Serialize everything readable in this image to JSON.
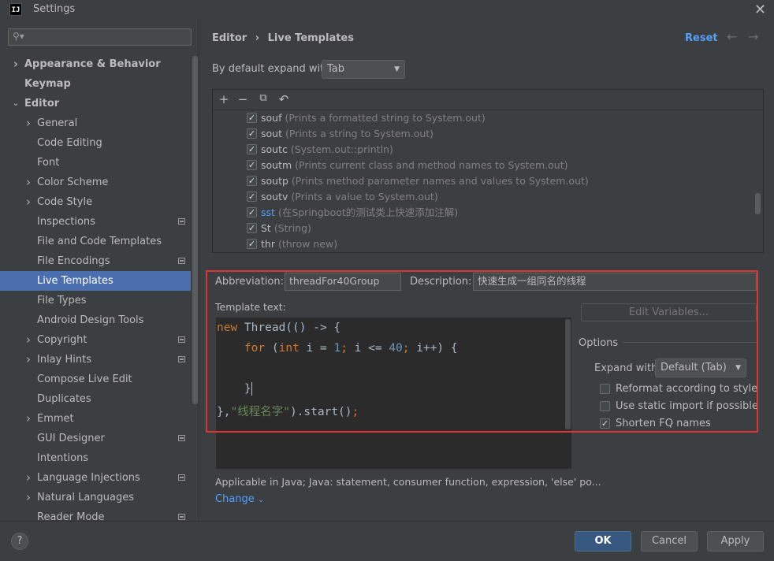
{
  "window": {
    "title": "Settings",
    "logo": "IJ"
  },
  "sidebar": {
    "search_placeholder": "",
    "items": [
      {
        "label": "Appearance & Behavior",
        "level": 0,
        "bold": true,
        "chevron": "right"
      },
      {
        "label": "Keymap",
        "level": 0,
        "bold": true
      },
      {
        "label": "Editor",
        "level": 0,
        "bold": true,
        "chevron": "down"
      },
      {
        "label": "General",
        "level": 1,
        "chevron": "right"
      },
      {
        "label": "Code Editing",
        "level": 1
      },
      {
        "label": "Font",
        "level": 1
      },
      {
        "label": "Color Scheme",
        "level": 1,
        "chevron": "right"
      },
      {
        "label": "Code Style",
        "level": 1,
        "chevron": "right"
      },
      {
        "label": "Inspections",
        "level": 1,
        "badge": true
      },
      {
        "label": "File and Code Templates",
        "level": 1
      },
      {
        "label": "File Encodings",
        "level": 1,
        "badge": true
      },
      {
        "label": "Live Templates",
        "level": 1,
        "selected": true
      },
      {
        "label": "File Types",
        "level": 1
      },
      {
        "label": "Android Design Tools",
        "level": 1
      },
      {
        "label": "Copyright",
        "level": 1,
        "chevron": "right",
        "badge": true
      },
      {
        "label": "Inlay Hints",
        "level": 1,
        "chevron": "right",
        "badge": true
      },
      {
        "label": "Compose Live Edit",
        "level": 1
      },
      {
        "label": "Duplicates",
        "level": 1
      },
      {
        "label": "Emmet",
        "level": 1,
        "chevron": "right"
      },
      {
        "label": "GUI Designer",
        "level": 1,
        "badge": true
      },
      {
        "label": "Intentions",
        "level": 1
      },
      {
        "label": "Language Injections",
        "level": 1,
        "chevron": "right",
        "badge": true
      },
      {
        "label": "Natural Languages",
        "level": 1,
        "chevron": "right"
      },
      {
        "label": "Reader Mode",
        "level": 1,
        "badge": true
      }
    ]
  },
  "header": {
    "breadcrumb": [
      "Editor",
      "›",
      "Live Templates"
    ],
    "reset_label": "Reset"
  },
  "expand": {
    "label": "By default expand with",
    "value": "Tab"
  },
  "templates": [
    {
      "name": "souf",
      "desc": "(Prints a formatted string to System.out)",
      "checked": true
    },
    {
      "name": "sout",
      "desc": "(Prints a string to System.out)",
      "checked": true
    },
    {
      "name": "soutc",
      "desc": "(System.out::println)",
      "checked": true
    },
    {
      "name": "soutm",
      "desc": "(Prints current class and method names to System.out)",
      "checked": true
    },
    {
      "name": "soutp",
      "desc": "(Prints method parameter names and values to System.out)",
      "checked": true
    },
    {
      "name": "soutv",
      "desc": "(Prints a value to System.out)",
      "checked": true
    },
    {
      "name": "sst",
      "desc": "(在Springboot的测试类上快速添加注解)",
      "checked": true,
      "highlight": true
    },
    {
      "name": "St",
      "desc": "(String)",
      "checked": true
    },
    {
      "name": "thr",
      "desc": "(throw new)",
      "checked": true
    }
  ],
  "editor": {
    "abbreviation_label": "Abbreviation:",
    "abbreviation_value": "threadFor40Group",
    "description_label": "Description:",
    "description_value": "快速生成一组同名的线程",
    "template_text_label": "Template text:",
    "code": {
      "l1_kw": "new",
      "l1_rest": " Thread(() -> {",
      "l2_kw": "for",
      "l2_open": " (",
      "l2_int": "int",
      "l2_mid": " i = ",
      "l2_n1": "1",
      "l2_semi1": ";",
      "l2_mid2": " i <= ",
      "l2_n2": "40",
      "l2_semi2": ";",
      "l2_end": " i++) {",
      "l4_brace": "}",
      "l5_a": "},",
      "l5_str": "\"线程名字\"",
      "l5_b": ").start()",
      "l5_semi": ";"
    },
    "edit_variables_label": "Edit Variables...",
    "applicable_text": "Applicable in Java; Java: statement, consumer function, expression, 'else' po...",
    "change_label": "Change"
  },
  "options": {
    "title": "Options",
    "expand_with_label": "Expand with",
    "expand_with_value": "Default (Tab)",
    "reformat_label": "Reformat according to style",
    "reformat_checked": false,
    "static_import_label": "Use static import if possible",
    "static_import_checked": false,
    "shorten_fq_label": "Shorten FQ names",
    "shorten_fq_checked": true
  },
  "buttons": {
    "help": "?",
    "ok": "OK",
    "cancel": "Cancel",
    "apply": "Apply"
  },
  "colors": {
    "accent": "#4b6eaf",
    "link": "#589df6",
    "highlight_border": "#e03434"
  }
}
